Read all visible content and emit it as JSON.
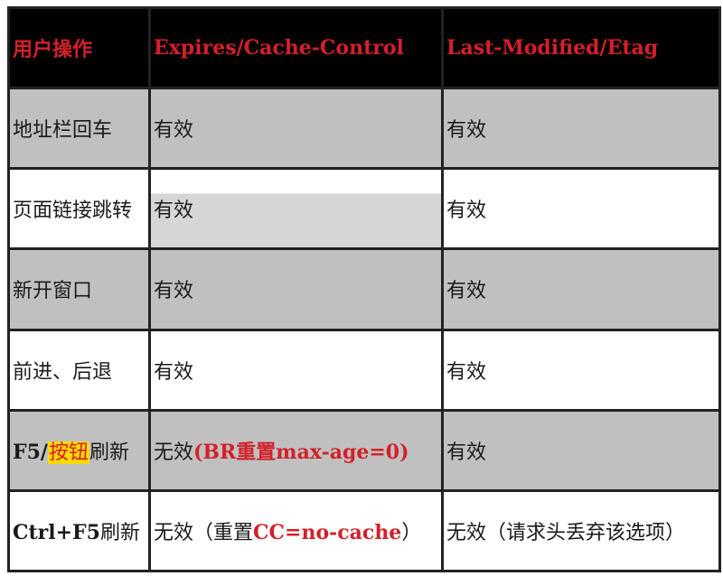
{
  "header": {
    "col1": "用户操作",
    "col2": "Expires/Cache-Control",
    "col3": "Last-Modified/Etag"
  },
  "rows": [
    {
      "op": "地址栏回车",
      "expires": "有效",
      "lastmod": "有效"
    },
    {
      "op": "页面链接跳转",
      "expires": "有效",
      "lastmod": "有效"
    },
    {
      "op": "新开窗口",
      "expires": "有效",
      "lastmod": "有效"
    },
    {
      "op": "前进、后退",
      "expires": "有效",
      "lastmod": "有效"
    },
    {
      "op_prefix": "F5/",
      "op_highlight": "按钮",
      "op_suffix": "刷新",
      "expires_prefix": "无效",
      "expires_rest": "(BR重置max-age=0)",
      "lastmod": "有效"
    },
    {
      "op_prefix": "Ctrl+F5",
      "op_suffix": "刷新",
      "expires_prefix": "无效（重置",
      "expires_latin": "CC=no-cache",
      "expires_close": "）",
      "lastmod": "无效（请求头丢弃该选项）"
    }
  ],
  "colors": {
    "header_bg": "#000000",
    "header_text": "#d4202a",
    "row_gray": "#c0c0c0",
    "row_white": "#ffffff",
    "highlight": "#ffd900",
    "red": "#d4202a"
  }
}
